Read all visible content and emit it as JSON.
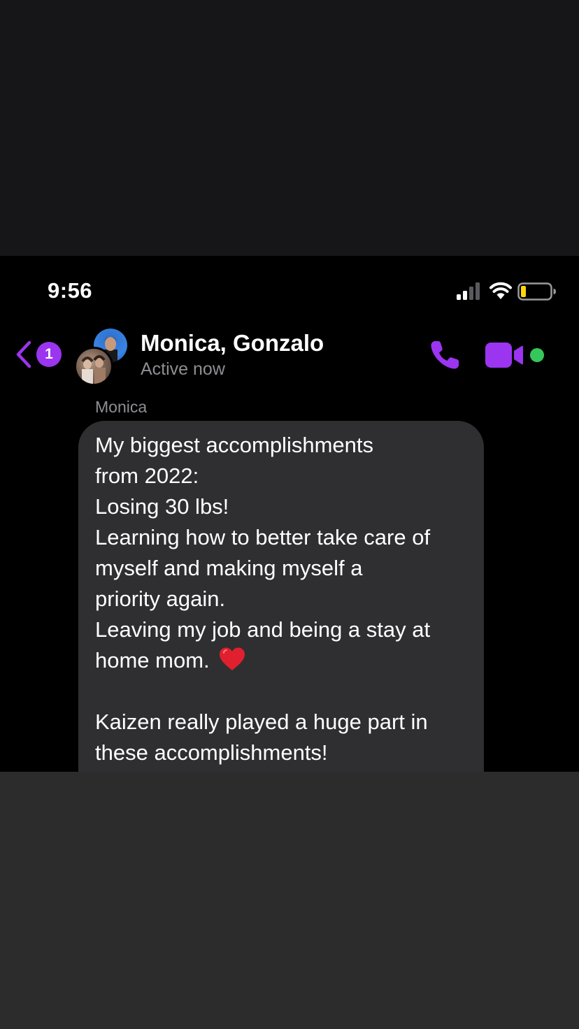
{
  "status_bar": {
    "time": "9:56"
  },
  "header": {
    "back_badge_count": "1",
    "contact_name": "Monica, Gonzalo",
    "active_status": "Active now"
  },
  "message": {
    "sender": "Monica",
    "lines_before_emoji": "My biggest accomplishments\nfrom 2022:\nLosing 30 lbs!\nLearning how to better take care of\nmyself and making myself a\npriority again.\nLeaving my job and being a stay at\nhome mom. ",
    "emoji": "❤️",
    "lines_after_emoji": "\n\nKaizen really played a huge part in\nthese accomplishments!"
  },
  "icons": {
    "back": "chevron-left-icon",
    "call": "phone-icon",
    "video": "video-camera-icon",
    "signal": "cellular-signal-icon",
    "wifi": "wifi-icon",
    "battery": "battery-low-icon"
  },
  "colors": {
    "accent": "#9b35f0",
    "active_dot": "#35c759",
    "battery_low": "#ffd60a",
    "bubble": "#2f2f31",
    "secondary_text": "#8e8e93"
  }
}
